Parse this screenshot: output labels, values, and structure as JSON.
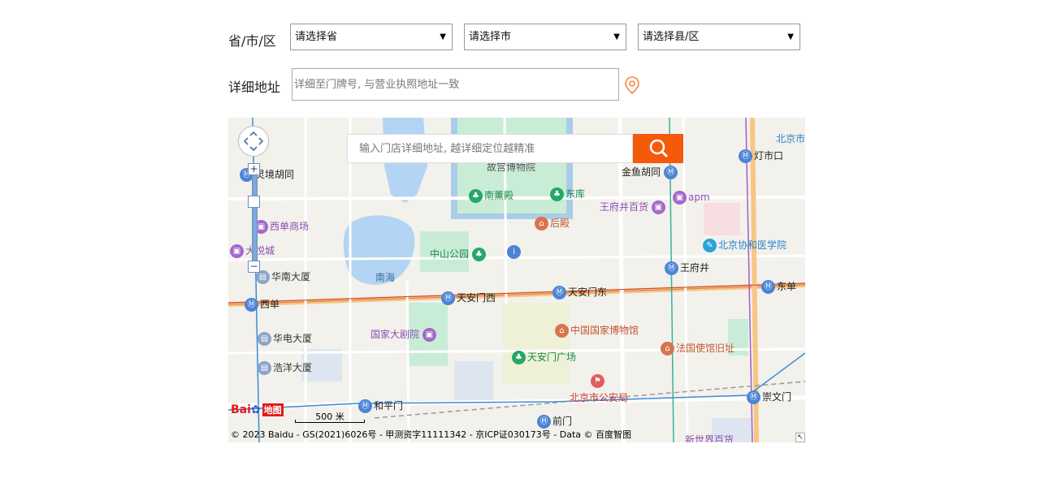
{
  "form": {
    "region_label": "省/市/区",
    "province_select": "请选择省",
    "city_select": "请选择市",
    "district_select": "请选择县/区",
    "address_label": "详细地址",
    "address_placeholder": "详细至门牌号, 与营业执照地址一致"
  },
  "map": {
    "search_placeholder": "输入门店详细地址, 越详细定位越精准",
    "scale_label": "500 米",
    "copyright": "© 2023 Baidu - GS(2021)6026号 - 甲测资字11111342 - 京ICP证030173号 - Data © 百度智图",
    "logo_text": "Bai",
    "logo_box": "地图",
    "zoom_in": "+",
    "zoom_out": "−",
    "labels": {
      "gugong": "故宫博物院",
      "jinyu": "金鱼胡同",
      "dengshikou": "灯市口",
      "beijingshi": "北京市",
      "lingjing": "灵境胡同",
      "nanxundian": "南薰殿",
      "dongku": "东库",
      "wangfujing_bh": "王府井百货",
      "apm": "apm",
      "xidan_sc": "西单商场",
      "houdian": "后殿",
      "xieheyx": "北京协和医学院",
      "dayuecheng": "大悦城",
      "zhongshan": "中山公园",
      "wangfujing": "王府井",
      "huanan": "华南大厦",
      "nanhai": "南海",
      "tam_xi": "天安门西",
      "tam_dong": "天安门东",
      "dongdan": "东单",
      "xidan": "西单",
      "guojia_jyy": "国家大剧院",
      "guojia_bwg": "中国国家博物馆",
      "huadian": "华电大厦",
      "faguo": "法国使馆旧址",
      "tam_gc": "天安门广场",
      "haoyang": "浩洋大厦",
      "gonganju": "北京市公安局",
      "hepingmen": "和平门",
      "chongwenmen": "崇文门",
      "qianmen": "前门",
      "xinshijie": "新世界百货"
    }
  }
}
